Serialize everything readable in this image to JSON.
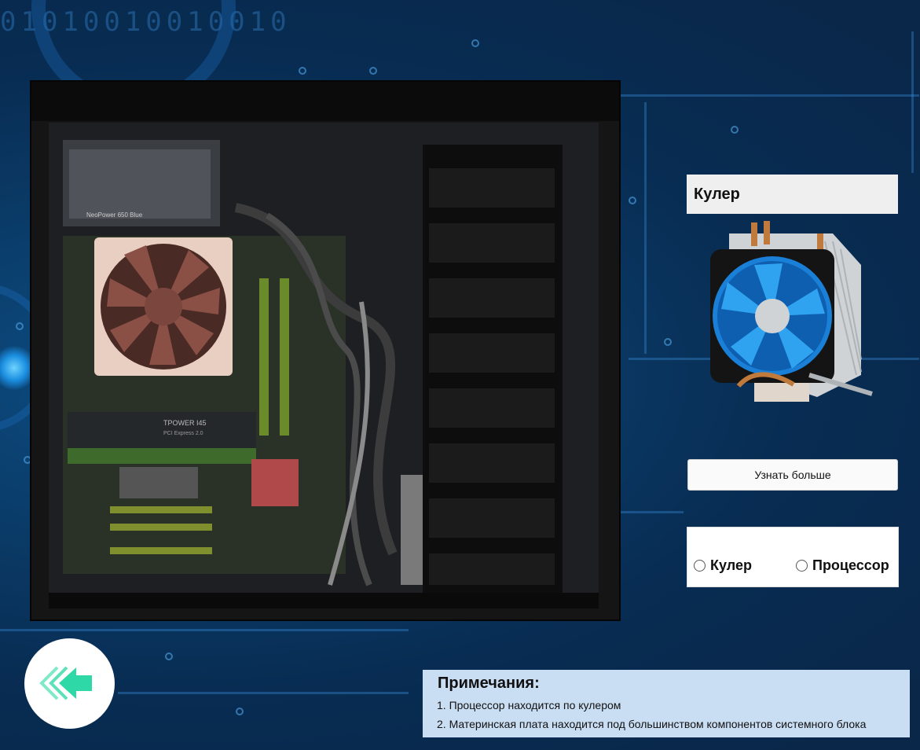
{
  "background": {
    "binary_text": "01010010010010",
    "colors": {
      "base": "#0a3a66",
      "accent": "#1b8ee0"
    }
  },
  "case_image": {
    "icon": "computer-case-icon",
    "psu_label": "NeoPower 650 Blue",
    "gpu_label": "TPOWER I45",
    "gpu_sublabel": "PCI Express 2.0"
  },
  "component": {
    "title": "Кулер",
    "image_icon": "cpu-cooler-icon",
    "more_button": "Узнать больше"
  },
  "choice": {
    "options": [
      {
        "label": "Кулер"
      },
      {
        "label": "Процессор"
      }
    ]
  },
  "back_button": {
    "icon": "double-arrow-left-icon",
    "color": "#2fd9a7"
  },
  "notes": {
    "title": "Примечания:",
    "items": [
      "1. Процессор находится по кулером",
      "2. Материнская плата находится под большинством компонентов системного блока"
    ]
  }
}
